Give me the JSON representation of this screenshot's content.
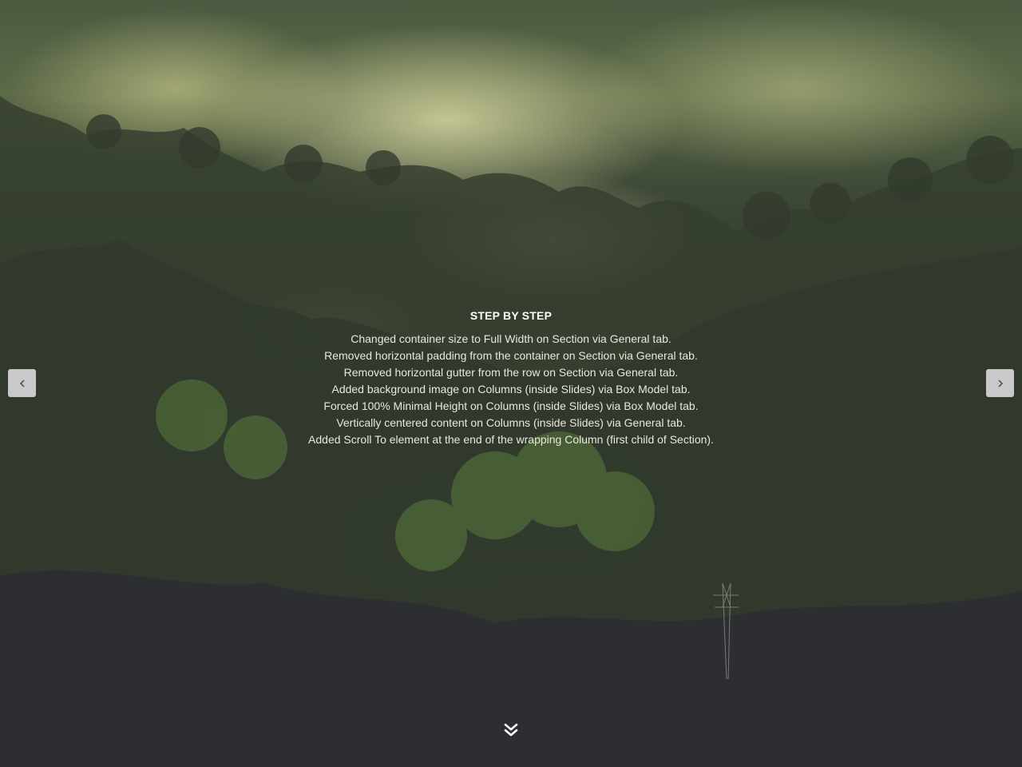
{
  "slide": {
    "background": "misty forest hillside",
    "heading": "STEP BY STEP",
    "steps": [
      "Changed container size to Full Width on Section via General tab.",
      "Removed horizontal padding from the container on Section via General tab.",
      "Removed horizontal gutter from the row on Section via General tab.",
      "Added background image on Columns (inside Slides) via Box Model tab.",
      "Forced 100% Minimal Height on Columns (inside Slides) via Box Model tab.",
      "Vertically centered content on Columns (inside Slides) via General tab.",
      "Added Scroll To element at the end of the wrapping Column (first child of Section)."
    ]
  },
  "controls": {
    "prev_icon": "chevron-left-icon",
    "next_icon": "chevron-right-icon",
    "scroll_icon": "double-chevron-down-icon"
  },
  "colors": {
    "text": "#e8e8de",
    "heading": "#ffffff",
    "nav_button_bg": "#c9c9cc",
    "nav_arrow": "#555555"
  }
}
